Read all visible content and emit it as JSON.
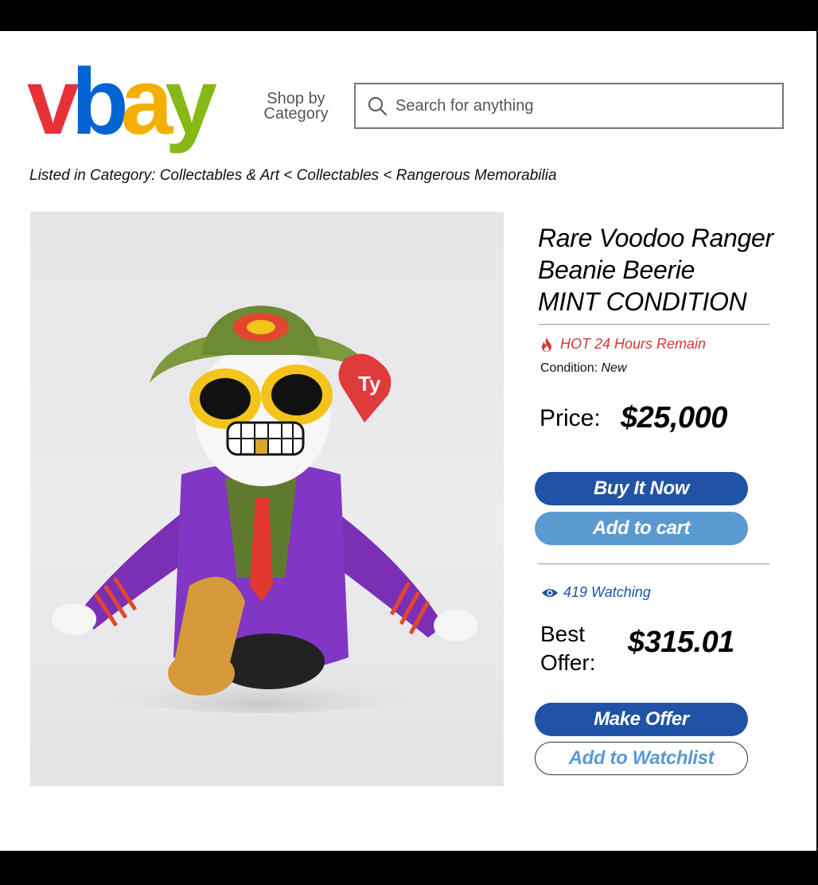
{
  "logo": {
    "letters": [
      {
        "char": "v",
        "color": "#e53238"
      },
      {
        "char": "b",
        "color": "#0064d2"
      },
      {
        "char": "a",
        "color": "#f5af02"
      },
      {
        "char": "y",
        "color": "#86b817"
      }
    ]
  },
  "header": {
    "shop_by_line1": "Shop by",
    "shop_by_line2": "Category",
    "search_placeholder": "Search for anything",
    "search_icon": "search-icon"
  },
  "breadcrumb": "Listed in Category: Collectables & Art < Collectables < Rangerous Memorabilia",
  "product": {
    "image_alt": "Voodoo Ranger plush toy",
    "title_lines": [
      "Rare Voodoo Ranger",
      "Beanie Beerie",
      "MINT CONDITION"
    ],
    "hot_text": "HOT 24 Hours Remain",
    "hot_icon": "flame-icon",
    "condition_label": "Condition:",
    "condition_value": "New",
    "price_label": "Price:",
    "price_value": "$25,000",
    "buy_now_label": "Buy It Now",
    "add_to_cart_label": "Add to cart",
    "watching_text": "419 Watching",
    "watching_icon": "eye-icon",
    "best_offer_line1": "Best",
    "best_offer_line2": "Offer:",
    "best_offer_value": "$315.01",
    "make_offer_label": "Make Offer",
    "add_to_watchlist_label": "Add to Watchlist"
  },
  "colors": {
    "primary_blue": "#2053a5",
    "light_blue": "#5b9ad0",
    "hot_red": "#d33a3a"
  }
}
